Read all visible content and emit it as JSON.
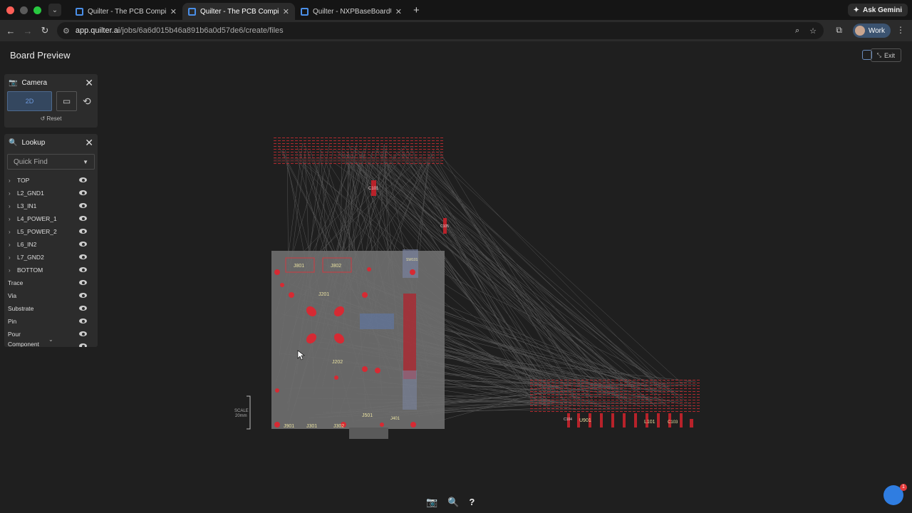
{
  "browser": {
    "tabs": [
      {
        "title": "Quilter - The PCB Compiler",
        "active": false
      },
      {
        "title": "Quilter - The PCB Compiler",
        "active": true
      },
      {
        "title": "Quilter - NXPBaseBoardUNP...",
        "active": false
      }
    ],
    "ask_gemini": "Ask Gemini",
    "url_host": "app.quilter.ai",
    "url_path": "/jobs/6a6d015b46a891b6a0d57de6/create/files",
    "profile_label": "Work"
  },
  "app": {
    "title": "Board Preview",
    "exit_label": "Exit"
  },
  "camera_panel": {
    "title": "Camera",
    "mode_2d": "2D",
    "reset_label": "Reset"
  },
  "lookup_panel": {
    "title": "Lookup",
    "quick_find_placeholder": "Quick Find",
    "layers": [
      "TOP",
      "L2_GND1",
      "L3_IN1",
      "L4_POWER_1",
      "L5_POWER_2",
      "L6_IN2",
      "L7_GND2",
      "BOTTOM"
    ],
    "objects": [
      "Trace",
      "Via",
      "Substrate",
      "Pin",
      "Pour",
      "Component"
    ]
  },
  "board": {
    "scale_label": "SCALE",
    "scale_value": "20mm",
    "designators": [
      "J801",
      "J802",
      "J201",
      "J202",
      "J901",
      "J301",
      "J302",
      "J501",
      "J401",
      "C101",
      "C105",
      "U901",
      "L101",
      "C103",
      "C104",
      "SW101"
    ]
  },
  "chat": {
    "badge": "1"
  },
  "colors": {
    "accent": "#2f7de1",
    "component": "#e0323a",
    "board": "#6f6f6f"
  }
}
